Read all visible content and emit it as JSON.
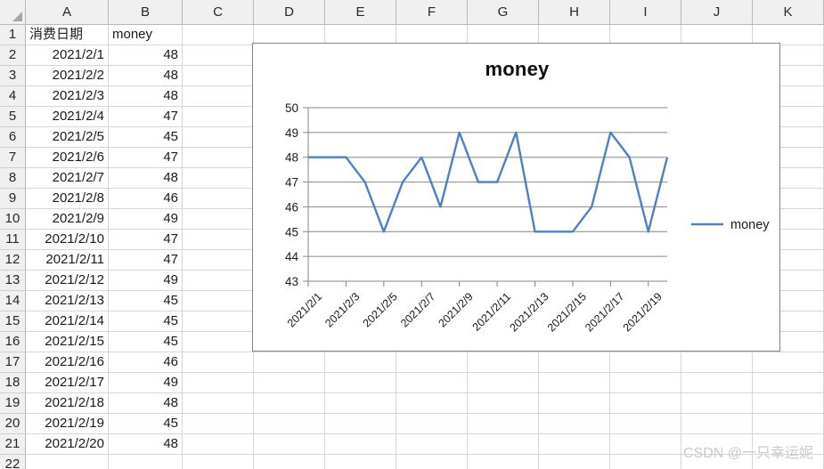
{
  "sheet": {
    "column_headers": [
      "A",
      "B",
      "C",
      "D",
      "E",
      "F",
      "G",
      "H",
      "I",
      "J",
      "K"
    ],
    "row_headers": [
      "1",
      "2",
      "3",
      "4",
      "5",
      "6",
      "7",
      "8",
      "9",
      "10",
      "11",
      "12",
      "13",
      "14",
      "15",
      "16",
      "17",
      "18",
      "19",
      "20",
      "21",
      "22"
    ],
    "header_a": "消费日期",
    "header_b": "money",
    "rows": [
      {
        "date": "2021/2/1",
        "money": "48"
      },
      {
        "date": "2021/2/2",
        "money": "48"
      },
      {
        "date": "2021/2/3",
        "money": "48"
      },
      {
        "date": "2021/2/4",
        "money": "47"
      },
      {
        "date": "2021/2/5",
        "money": "45"
      },
      {
        "date": "2021/2/6",
        "money": "47"
      },
      {
        "date": "2021/2/7",
        "money": "48"
      },
      {
        "date": "2021/2/8",
        "money": "46"
      },
      {
        "date": "2021/2/9",
        "money": "49"
      },
      {
        "date": "2021/2/10",
        "money": "47"
      },
      {
        "date": "2021/2/11",
        "money": "47"
      },
      {
        "date": "2021/2/12",
        "money": "49"
      },
      {
        "date": "2021/2/13",
        "money": "45"
      },
      {
        "date": "2021/2/14",
        "money": "45"
      },
      {
        "date": "2021/2/15",
        "money": "45"
      },
      {
        "date": "2021/2/16",
        "money": "46"
      },
      {
        "date": "2021/2/17",
        "money": "49"
      },
      {
        "date": "2021/2/18",
        "money": "48"
      },
      {
        "date": "2021/2/19",
        "money": "45"
      },
      {
        "date": "2021/2/20",
        "money": "48"
      }
    ]
  },
  "chart_data": {
    "type": "line",
    "title": "money",
    "xlabel": "",
    "ylabel": "",
    "categories": [
      "2021/2/1",
      "2021/2/2",
      "2021/2/3",
      "2021/2/4",
      "2021/2/5",
      "2021/2/6",
      "2021/2/7",
      "2021/2/8",
      "2021/2/9",
      "2021/2/10",
      "2021/2/11",
      "2021/2/12",
      "2021/2/13",
      "2021/2/14",
      "2021/2/15",
      "2021/2/16",
      "2021/2/17",
      "2021/2/18",
      "2021/2/19",
      "2021/2/20"
    ],
    "x_tick_labels": [
      "2021/2/1",
      "2021/2/3",
      "2021/2/5",
      "2021/2/7",
      "2021/2/9",
      "2021/2/11",
      "2021/2/13",
      "2021/2/15",
      "2021/2/17",
      "2021/2/19"
    ],
    "y_tick_labels": [
      "43",
      "44",
      "45",
      "46",
      "47",
      "48",
      "49",
      "50"
    ],
    "ylim": [
      43,
      50
    ],
    "grid": true,
    "legend_position": "right",
    "series": [
      {
        "name": "money",
        "color": "#4e81c4",
        "values": [
          48,
          48,
          48,
          47,
          45,
          47,
          48,
          46,
          49,
          47,
          47,
          49,
          45,
          45,
          45,
          46,
          49,
          48,
          45,
          48
        ]
      }
    ]
  },
  "watermark": {
    "text": "CSDN @一只幸运妮"
  }
}
